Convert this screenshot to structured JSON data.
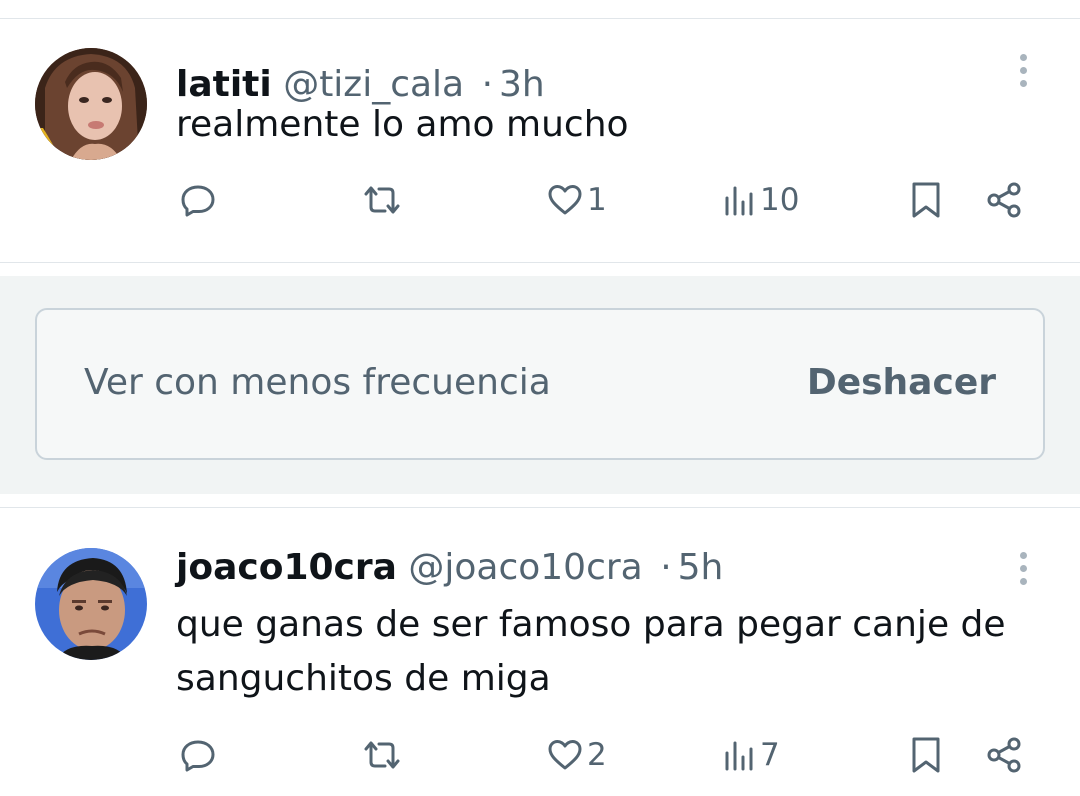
{
  "feed": {
    "tweets": [
      {
        "display_name": "latiti",
        "handle": "@tizi_cala",
        "separator": "·",
        "time": "3h",
        "text": "realmente lo amo mucho",
        "actions": {
          "reply_count": "",
          "retweet_count": "",
          "like_count": "1",
          "views_count": "10"
        }
      },
      {
        "display_name": "joaco10cra",
        "handle": "@joaco10cra",
        "separator": "·",
        "time": "5h",
        "text": "que ganas de ser famoso para pegar canje de sanguchitos de miga",
        "actions": {
          "reply_count": "",
          "retweet_count": "",
          "like_count": "2",
          "views_count": "7"
        }
      }
    ],
    "feedback_banner": {
      "message": "Ver con menos frecuencia",
      "undo_label": "Deshacer"
    }
  },
  "icons": {
    "reply": "reply-icon",
    "retweet": "retweet-icon",
    "like": "heart-icon",
    "views": "views-icon",
    "bookmark": "bookmark-icon",
    "share": "share-icon",
    "more": "more-vertical-icon"
  },
  "colors": {
    "text_primary": "#0f1419",
    "text_secondary": "#536471",
    "divider": "#e1e6ea",
    "banner_bg": "#f1f4f4",
    "banner_border": "#c9d3da"
  }
}
